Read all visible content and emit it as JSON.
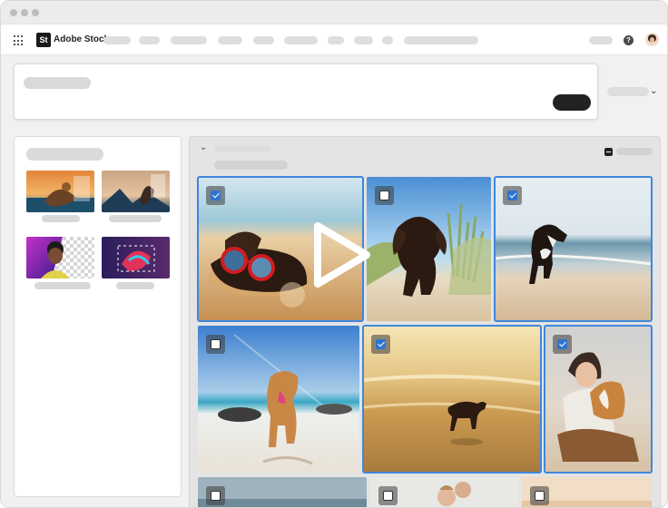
{
  "app": {
    "logo_text": "St",
    "brand_name": "Adobe Stock"
  },
  "icons": {
    "apps": "app-grid-icon",
    "help": "help-icon",
    "avatar": "user-avatar",
    "sort": "chevron-down-icon",
    "collapse": "chevron-down-icon",
    "deselect": "minus-checkbox-icon",
    "play": "play-icon"
  },
  "help_glyph": "?",
  "chevron_glyph": "⌄",
  "colors": {
    "accent": "#3f87dc",
    "checkbox_checked": "#2f74d0",
    "search_button": "#222222"
  },
  "results": {
    "tiles": [
      {
        "name": "dog-sunglasses-beach",
        "checked": true
      },
      {
        "name": "dog-dunes",
        "checked": false
      },
      {
        "name": "dog-running-shore",
        "checked": true
      },
      {
        "name": "dog-sandy-beach",
        "checked": false
      },
      {
        "name": "dog-sunset-water",
        "checked": true
      },
      {
        "name": "woman-hugging-dog",
        "checked": true
      },
      {
        "name": "ocean-tile",
        "checked": false
      },
      {
        "name": "family-tile",
        "checked": false
      },
      {
        "name": "sunset-tile",
        "checked": false
      }
    ]
  }
}
